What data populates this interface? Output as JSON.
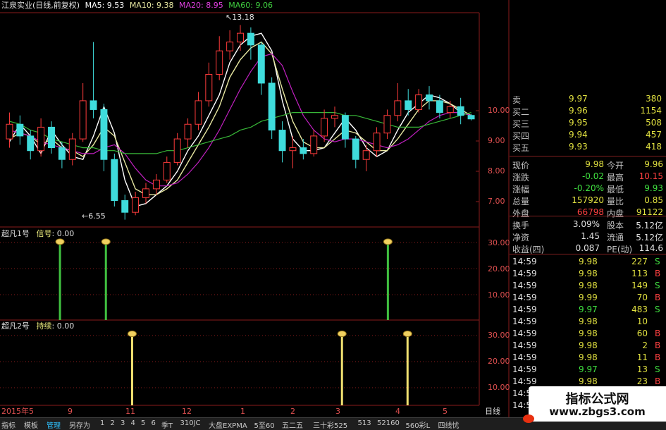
{
  "header": {
    "stock": "江泉实业(日线,前复权)",
    "ma5": "MA5: 9.53",
    "ma10": "MA10: 9.38",
    "ma20": "MA20: 8.95",
    "ma60": "MA60: 9.06"
  },
  "colors": {
    "up": "#ff3b3b",
    "down": "#3fdcdc",
    "ma5": "#ffffff",
    "ma10": "#e6e6a0",
    "ma20": "#c020c0",
    "ma60": "#38b838",
    "signal_green": "#40c040",
    "signal_yellow": "#f0e070",
    "grid": "#8a1c1c"
  },
  "chart_data": [
    {
      "type": "candlestick",
      "title": "江泉实业(日线,前复权)",
      "ylim": [
        6.3,
        13.6
      ],
      "y_ticks": [
        "10.00",
        "9.00",
        "8.00",
        "7.00"
      ],
      "annotations": [
        "13.18",
        "6.55"
      ],
      "x_ticks": [
        "2015年5",
        "9",
        "11",
        "12",
        "1",
        "2",
        "3",
        "4",
        "5"
      ],
      "period_label": "日线",
      "ma_series": [
        {
          "name": "MA5",
          "values": [
            9.2,
            9.8,
            9.4,
            8.8,
            9.6,
            9.1,
            8.7,
            8.6,
            9.4,
            10.4,
            9.5,
            7.9,
            7.0,
            7.1,
            7.4,
            7.7,
            8.2,
            8.9,
            9.4,
            10.1,
            10.8,
            11.9,
            12.5,
            12.8,
            12.9,
            12.3,
            10.6,
            9.3,
            8.9,
            8.9,
            9.0,
            9.5,
            10.0,
            9.6,
            9.0,
            8.7,
            8.9,
            9.6,
            10.2,
            10.5,
            10.8,
            10.7,
            10.5,
            10.2,
            10.1
          ]
        },
        {
          "name": "MA10",
          "values": [
            9.3,
            9.5,
            9.4,
            9.1,
            9.3,
            9.0,
            8.9,
            8.7,
            9.1,
            9.7,
            9.4,
            8.5,
            7.6,
            7.4,
            7.4,
            7.6,
            7.9,
            8.5,
            9.1,
            9.7,
            10.4,
            11.4,
            12.0,
            12.4,
            12.6,
            12.2,
            11.0,
            9.9,
            9.2,
            9.0,
            9.0,
            9.3,
            9.6,
            9.5,
            9.2,
            8.9,
            8.9,
            9.3,
            9.8,
            10.3,
            10.6,
            10.6,
            10.5,
            10.3,
            10.1
          ]
        },
        {
          "name": "MA20",
          "values": [
            9.6,
            9.5,
            9.4,
            9.2,
            9.1,
            9.0,
            8.9,
            8.8,
            8.8,
            9.0,
            9.1,
            8.8,
            8.3,
            7.9,
            7.7,
            7.7,
            7.8,
            8.1,
            8.5,
            9.0,
            9.6,
            10.3,
            11.0,
            11.6,
            12.1,
            12.2,
            11.8,
            10.9,
            10.1,
            9.6,
            9.3,
            9.2,
            9.3,
            9.3,
            9.2,
            9.1,
            9.0,
            9.1,
            9.3,
            9.6,
            9.9,
            10.1,
            10.2,
            10.2,
            10.1
          ]
        },
        {
          "name": "MA60",
          "values": [
            9.9,
            9.8,
            9.6,
            9.5,
            9.3,
            9.2,
            9.1,
            9.0,
            9.0,
            8.9,
            8.9,
            8.8,
            8.8,
            8.8,
            8.8,
            8.9,
            8.9,
            9.0,
            9.1,
            9.2,
            9.3,
            9.4,
            9.6,
            9.7,
            9.9,
            10.0,
            10.1,
            10.2,
            10.2,
            10.2,
            10.2,
            10.2,
            10.1,
            10.1,
            10.0,
            9.9,
            9.8,
            9.7,
            9.7,
            9.7,
            9.8,
            9.9,
            10.0,
            10.1,
            10.2
          ]
        }
      ],
      "candles": [
        {
          "o": 9.3,
          "c": 9.8,
          "h": 10.2,
          "l": 9.0
        },
        {
          "o": 9.8,
          "c": 9.4,
          "h": 10.1,
          "l": 9.1
        },
        {
          "o": 9.4,
          "c": 8.9,
          "h": 9.6,
          "l": 8.6
        },
        {
          "o": 8.9,
          "c": 9.7,
          "h": 10.0,
          "l": 8.7
        },
        {
          "o": 9.7,
          "c": 9.0,
          "h": 9.9,
          "l": 8.8
        },
        {
          "o": 9.0,
          "c": 8.6,
          "h": 9.2,
          "l": 8.3
        },
        {
          "o": 8.6,
          "c": 9.3,
          "h": 9.5,
          "l": 8.4
        },
        {
          "o": 9.3,
          "c": 10.6,
          "h": 11.2,
          "l": 9.2
        },
        {
          "o": 10.6,
          "c": 10.3,
          "h": 12.6,
          "l": 10.0
        },
        {
          "o": 10.3,
          "c": 8.6,
          "h": 10.5,
          "l": 8.2
        },
        {
          "o": 8.6,
          "c": 7.2,
          "h": 8.8,
          "l": 7.0
        },
        {
          "o": 7.2,
          "c": 6.8,
          "h": 7.4,
          "l": 6.55
        },
        {
          "o": 6.8,
          "c": 7.3,
          "h": 7.5,
          "l": 6.7
        },
        {
          "o": 7.3,
          "c": 7.6,
          "h": 7.8,
          "l": 7.1
        },
        {
          "o": 7.6,
          "c": 7.9,
          "h": 8.1,
          "l": 7.4
        },
        {
          "o": 7.9,
          "c": 8.5,
          "h": 8.7,
          "l": 7.8
        },
        {
          "o": 8.5,
          "c": 9.3,
          "h": 9.5,
          "l": 8.4
        },
        {
          "o": 9.3,
          "c": 9.8,
          "h": 10.0,
          "l": 9.0
        },
        {
          "o": 9.8,
          "c": 10.6,
          "h": 10.9,
          "l": 9.6
        },
        {
          "o": 10.6,
          "c": 11.5,
          "h": 11.9,
          "l": 10.4
        },
        {
          "o": 11.5,
          "c": 12.3,
          "h": 12.8,
          "l": 11.3
        },
        {
          "o": 12.3,
          "c": 12.6,
          "h": 13.0,
          "l": 12.0
        },
        {
          "o": 12.6,
          "c": 12.9,
          "h": 13.18,
          "l": 12.3
        },
        {
          "o": 12.9,
          "c": 12.5,
          "h": 13.1,
          "l": 12.0
        },
        {
          "o": 12.5,
          "c": 11.2,
          "h": 12.6,
          "l": 10.8
        },
        {
          "o": 11.2,
          "c": 9.6,
          "h": 11.4,
          "l": 9.3
        },
        {
          "o": 9.6,
          "c": 8.9,
          "h": 9.9,
          "l": 8.5
        },
        {
          "o": 8.9,
          "c": 9.0,
          "h": 9.4,
          "l": 8.3
        },
        {
          "o": 9.0,
          "c": 8.8,
          "h": 9.3,
          "l": 8.6
        },
        {
          "o": 8.8,
          "c": 9.4,
          "h": 9.6,
          "l": 8.7
        },
        {
          "o": 9.4,
          "c": 10.0,
          "h": 10.3,
          "l": 9.2
        },
        {
          "o": 10.0,
          "c": 10.1,
          "h": 10.4,
          "l": 9.7
        },
        {
          "o": 10.1,
          "c": 9.3,
          "h": 10.2,
          "l": 9.0
        },
        {
          "o": 9.3,
          "c": 8.6,
          "h": 9.4,
          "l": 8.3
        },
        {
          "o": 8.6,
          "c": 8.9,
          "h": 9.1,
          "l": 8.2
        },
        {
          "o": 8.9,
          "c": 9.5,
          "h": 9.7,
          "l": 8.7
        },
        {
          "o": 9.5,
          "c": 10.1,
          "h": 10.3,
          "l": 9.3
        },
        {
          "o": 10.1,
          "c": 10.6,
          "h": 11.2,
          "l": 9.9
        },
        {
          "o": 10.6,
          "c": 10.3,
          "h": 11.0,
          "l": 10.1
        },
        {
          "o": 10.3,
          "c": 10.8,
          "h": 11.0,
          "l": 10.2
        },
        {
          "o": 10.8,
          "c": 10.6,
          "h": 11.1,
          "l": 10.3
        },
        {
          "o": 10.6,
          "c": 10.2,
          "h": 10.8,
          "l": 10.0
        },
        {
          "o": 10.2,
          "c": 10.4,
          "h": 10.6,
          "l": 10.0
        },
        {
          "o": 10.4,
          "c": 10.1,
          "h": 10.7,
          "l": 9.8
        },
        {
          "o": 10.1,
          "c": 9.98,
          "h": 10.15,
          "l": 9.93
        }
      ]
    },
    {
      "type": "bar",
      "title": "超凡1号",
      "ylim": [
        0,
        34
      ],
      "y_ticks": [
        "30.00",
        "20.00",
        "10.00"
      ],
      "series": [
        {
          "name": "信号",
          "value_label": "0.00",
          "x_index": [
            8,
            15,
            58
          ],
          "values": [
            30,
            30,
            30
          ]
        }
      ]
    },
    {
      "type": "bar",
      "title": "超凡2号",
      "ylim": [
        0,
        34
      ],
      "y_ticks": [
        "30.00",
        "20.00",
        "10.00"
      ],
      "series": [
        {
          "name": "持续",
          "value_label": "0.00",
          "x_index": [
            19,
            51,
            61
          ],
          "values": [
            30,
            30,
            30
          ]
        }
      ]
    }
  ],
  "quote": {
    "top_partial": {
      "label": "卖",
      "price": "9.97",
      "vol": "380"
    },
    "bids": [
      {
        "label": "买二",
        "price": "9.96",
        "vol": "1154"
      },
      {
        "label": "买三",
        "price": "9.95",
        "vol": "508"
      },
      {
        "label": "买四",
        "price": "9.94",
        "vol": "457"
      },
      {
        "label": "买五",
        "price": "9.93",
        "vol": "418"
      }
    ],
    "stats": [
      {
        "l1": "现价",
        "v1": "9.98",
        "l2": "今开",
        "v2": "9.96"
      },
      {
        "l1": "涨跌",
        "v1": "-0.02",
        "l2": "最高",
        "v2": "10.15"
      },
      {
        "l1": "涨幅",
        "v1": "-0.20%",
        "l2": "最低",
        "v2": "9.93"
      },
      {
        "l1": "总量",
        "v1": "157920",
        "l2": "量比",
        "v2": "0.85"
      },
      {
        "l1": "外盘",
        "v1": "66798",
        "l2": "内盘",
        "v2": "91122"
      }
    ],
    "fundamentals": [
      {
        "l1": "换手",
        "v1": "3.09%",
        "l2": "股本",
        "v2": "5.12亿"
      },
      {
        "l1": "净资",
        "v1": "1.45",
        "l2": "流通",
        "v2": "5.12亿"
      },
      {
        "l1": "收益(四)",
        "v1": "0.087",
        "l2": "PE(动)",
        "v2": "114.6"
      }
    ],
    "ticks": [
      {
        "time": "14:59",
        "price": "9.98",
        "vol": "227",
        "side": "S"
      },
      {
        "time": "14:59",
        "price": "9.98",
        "vol": "113",
        "side": "B"
      },
      {
        "time": "14:59",
        "price": "9.98",
        "vol": "149",
        "side": "S"
      },
      {
        "time": "14:59",
        "price": "9.99",
        "vol": "70",
        "side": "B"
      },
      {
        "time": "14:59",
        "price": "9.97",
        "vol": "483",
        "side": "S"
      },
      {
        "time": "14:59",
        "price": "9.98",
        "vol": "10",
        "side": ""
      },
      {
        "time": "14:59",
        "price": "9.98",
        "vol": "60",
        "side": "B"
      },
      {
        "time": "14:59",
        "price": "9.98",
        "vol": "2",
        "side": "B"
      },
      {
        "time": "14:59",
        "price": "9.98",
        "vol": "11",
        "side": "B"
      },
      {
        "time": "14:59",
        "price": "9.97",
        "vol": "13",
        "side": "S"
      },
      {
        "time": "14:59",
        "price": "9.98",
        "vol": "23",
        "side": "B"
      },
      {
        "time": "14:59",
        "price": "9.97",
        "vol": "",
        "side": ""
      },
      {
        "time": "14:59",
        "price": "",
        "vol": "",
        "side": ""
      }
    ]
  },
  "tabs": [
    "指标",
    "模板",
    "管理",
    "另存为",
    "1",
    "2",
    "3",
    "4",
    "5",
    "6",
    "季T",
    "310JC",
    "大盘EXPMA",
    "5至60",
    "五二五",
    "三十彩525",
    "513",
    "52160",
    "560彩L",
    "四线忧"
  ],
  "active_tab": "管理",
  "watermark": {
    "line1": "指标公式网",
    "line2": "www.zbgs3.com"
  }
}
